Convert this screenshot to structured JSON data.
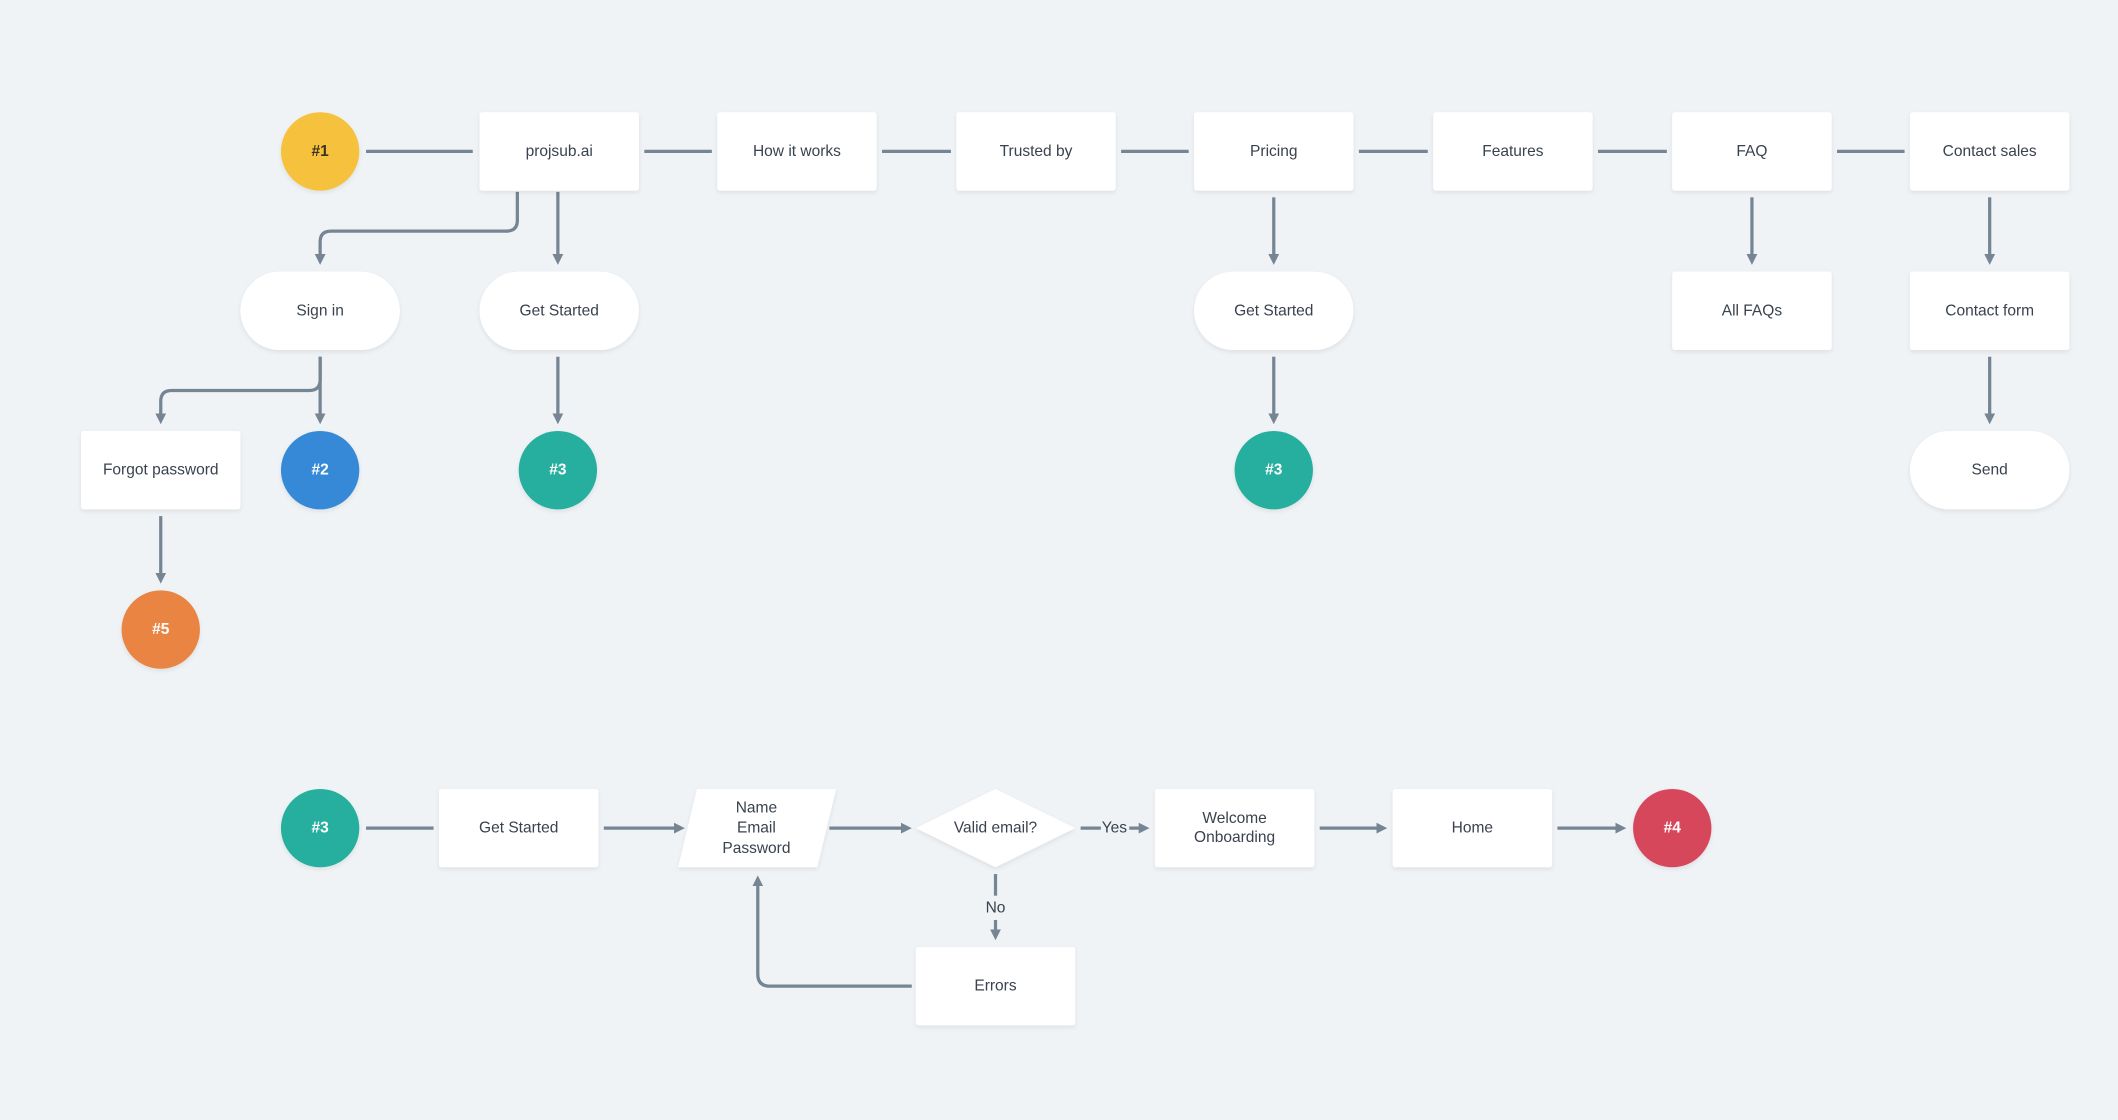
{
  "colors": {
    "background": "#eff3f6",
    "connector": "#768593",
    "yellow": "#f6c23e",
    "blue": "#3589d6",
    "teal": "#27ae9e",
    "orange": "#e98443",
    "red": "#d6475b"
  },
  "markers": {
    "m1": "#1",
    "m2": "#2",
    "m3": "#3",
    "m4": "#4",
    "m5": "#5"
  },
  "nav": {
    "home": "projsub.ai",
    "how": "How it works",
    "trusted": "Trusted by",
    "pricing": "Pricing",
    "features": "Features",
    "faq": "FAQ",
    "contact": "Contact sales"
  },
  "level2": {
    "signin": "Sign in",
    "get_started": "Get Started",
    "pricing_get_started": "Get Started",
    "all_faqs": "All FAQs",
    "contact_form": "Contact form"
  },
  "level3": {
    "forgot": "Forgot password",
    "send": "Send"
  },
  "signup_flow": {
    "get_started": "Get Started",
    "fields": [
      "Name",
      "Email",
      "Password"
    ],
    "decision": "Valid email?",
    "yes": "Yes",
    "no": "No",
    "errors": "Errors",
    "welcome": [
      "Welcome",
      "Onboarding"
    ],
    "home": "Home"
  }
}
